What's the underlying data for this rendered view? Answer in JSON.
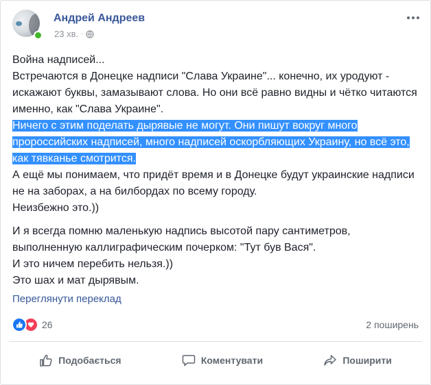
{
  "post": {
    "author": "Андрей Андреев",
    "time": "23 хв.",
    "privacy_icon": "globe-icon",
    "more_icon": "more-dots-icon"
  },
  "body": {
    "lines": [
      "Война надписей...",
      "Встречаются в Донецке надписи \"Слава Украине\"... конечно, их уродуют - искажают буквы, замазывают слова. Но они всё равно видны и чётко читаются именно, как \"Слава Украине\"."
    ],
    "highlighted": "Ничего с этим поделать дырявые не могут. Они пишут вокруг много пророссийских надписей, много надписей оскорбляющих Украину, но всё это, как тявканье смотрится.",
    "after_highlight": [
      "А ещё мы понимаем, что придёт время и в Донецке будут украинские надписи не на заборах, а на билбордах по всему городу.",
      "Неизбежно это.))"
    ],
    "para2": [
      "И я всегда помню маленькую надпись высотой пару сантиметров, выполненную каллиграфическим почерком: \"Тут був Вася\".",
      "И это ничем перебить нельзя.))",
      "Это шах и мат дырявым."
    ]
  },
  "translate_link": "Переглянути переклад",
  "reactions": {
    "count": "26",
    "types": [
      "like",
      "love"
    ],
    "shares": "2 поширень"
  },
  "actions": {
    "like": "Подобається",
    "comment": "Коментувати",
    "share": "Поширити"
  },
  "colors": {
    "link": "#385898",
    "highlight": "#3390ff",
    "like": "#1877f2",
    "love": "#f33e58",
    "online": "#42b72a"
  }
}
